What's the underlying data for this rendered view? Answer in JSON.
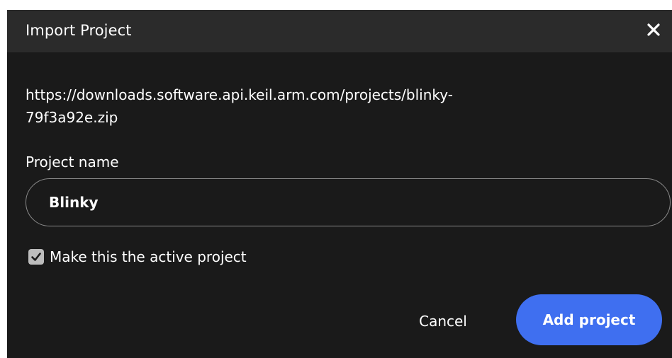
{
  "dialog": {
    "title": "Import Project",
    "close_icon": "close-icon",
    "url_line_1": "https://downloads.software.api.keil.arm.com/projects/blinky-",
    "url_line_2": "79f3a92e.zip",
    "project_name_label": "Project name",
    "project_name_value": "Blinky",
    "active_project_checked": true,
    "active_project_label": "Make this the active project",
    "cancel_label": "Cancel",
    "add_label": "Add project"
  },
  "colors": {
    "background": "#1a1a1a",
    "titlebar": "#2b2b2b",
    "primary_button": "#3f6ff0",
    "checkbox": "#bdbdbd"
  }
}
